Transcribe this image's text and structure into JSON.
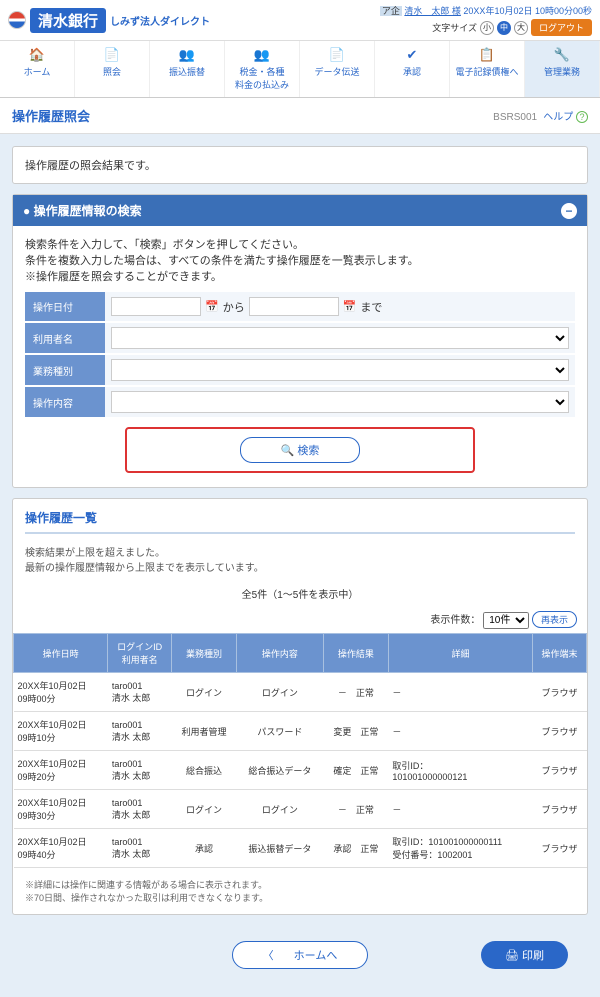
{
  "brand": {
    "bank": "清水銀行",
    "tagline": "しみず法人ダイレクト"
  },
  "user": {
    "badge": "ア企",
    "name": "清水　太郎 様",
    "timestamp": "20XX年10月02日 10時00分00秒"
  },
  "font_size": {
    "label": "文字サイズ",
    "small": "小",
    "med": "中",
    "large": "大"
  },
  "logout": "ログアウト",
  "nav": [
    {
      "icon": "🏠",
      "label": "ホーム"
    },
    {
      "icon": "📄",
      "label": "照会"
    },
    {
      "icon": "👥",
      "label": "振込振替"
    },
    {
      "icon": "👥",
      "label": "税金・各種\n料金の払込み"
    },
    {
      "icon": "📄",
      "label": "データ伝送"
    },
    {
      "icon": "✔",
      "label": "承認"
    },
    {
      "icon": "📋",
      "label": "電子記録債権へ"
    },
    {
      "icon": "🔧",
      "label": "管理業務"
    }
  ],
  "page": {
    "title": "操作履歴照会",
    "code": "BSRS001",
    "help": "ヘルプ"
  },
  "intro": "操作履歴の照会結果です。",
  "search": {
    "head": "操作履歴情報の検索",
    "desc1": "検索条件を入力して、「検索」ボタンを押してください。",
    "desc2": "条件を複数入力した場合は、すべての条件を満たす操作履歴を一覧表示します。",
    "desc3": "※操作履歴を照会することができます。",
    "date": "操作日付",
    "from": "から",
    "to": "まで",
    "user": "利用者名",
    "type": "業務種別",
    "content": "操作内容",
    "btn": "検索"
  },
  "list": {
    "title": "操作履歴一覧",
    "warn1": "検索結果が上限を超えました。",
    "warn2": "最新の操作履歴情報から上限までを表示しています。",
    "count": "全5件（1～5件を表示中）",
    "per": "表示件数：",
    "per_val": "10件",
    "reshow": "再表示",
    "cols": [
      "操作日時",
      "ログインID\n利用者名",
      "業務種別",
      "操作内容",
      "操作結果",
      "詳細",
      "操作端末"
    ]
  },
  "rows": [
    {
      "dt": "20XX年10月02日\n09時00分",
      "u": "taro001\n清水 太郎",
      "t": "ログイン",
      "c": "ログイン",
      "r": "－",
      "s": "正常",
      "d": "－",
      "term": "ブラウザ"
    },
    {
      "dt": "20XX年10月02日\n09時10分",
      "u": "taro001\n清水 太郎",
      "t": "利用者管理",
      "c": "パスワード",
      "r": "変更",
      "s": "正常",
      "d": "－",
      "term": "ブラウザ"
    },
    {
      "dt": "20XX年10月02日\n09時20分",
      "u": "taro001\n清水 太郎",
      "t": "総合振込",
      "c": "総合振込データ",
      "r": "確定",
      "s": "正常",
      "d": "取引ID：\n101001000000121",
      "term": "ブラウザ"
    },
    {
      "dt": "20XX年10月02日\n09時30分",
      "u": "taro001\n清水 太郎",
      "t": "ログイン",
      "c": "ログイン",
      "r": "－",
      "s": "正常",
      "d": "－",
      "term": "ブラウザ"
    },
    {
      "dt": "20XX年10月02日\n09時40分",
      "u": "taro001\n清水 太郎",
      "t": "承認",
      "c": "振込振替データ",
      "r": "承認",
      "s": "正常",
      "d": "取引ID：101001000000111\n受付番号：1002001",
      "term": "ブラウザ"
    }
  ],
  "footnote1": "※詳細には操作に関連する情報がある場合に表示されます。",
  "footnote2": "※70日間、操作されなかった取引は利用できなくなります。",
  "home_btn": "ホームへ",
  "print": "印刷"
}
